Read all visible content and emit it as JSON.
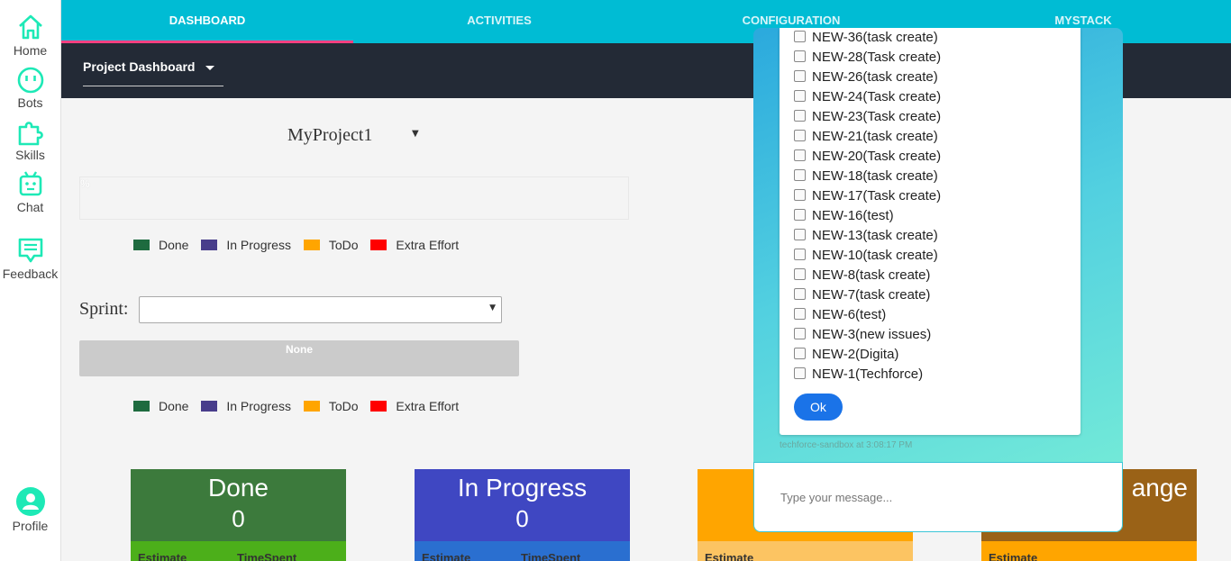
{
  "sidebar": {
    "items": [
      {
        "label": "Home",
        "icon": "home-icon"
      },
      {
        "label": "Bots",
        "icon": "bot-face-icon"
      },
      {
        "label": "Skills",
        "icon": "puzzle-icon"
      },
      {
        "label": "Chat",
        "icon": "robot-icon"
      },
      {
        "label": "Feedback",
        "icon": "message-icon"
      },
      {
        "label": "Profile",
        "icon": "user-icon"
      }
    ],
    "accent_color": "#1de9b6"
  },
  "tabs": [
    {
      "label": "DASHBOARD",
      "active": true
    },
    {
      "label": "ACTIVITIES",
      "active": false
    },
    {
      "label": "CONFIGURATION",
      "active": false
    },
    {
      "label": "MYSTACK",
      "active": false
    }
  ],
  "subheader": {
    "dropdown_label": "Project Dashboard"
  },
  "project": {
    "selected": "MyProject1"
  },
  "progress": {
    "label": "%"
  },
  "legend": [
    {
      "label": "Done",
      "color": "#1e6b3f"
    },
    {
      "label": "In Progress",
      "color": "#483d8b"
    },
    {
      "label": "ToDo",
      "color": "#ffa500"
    },
    {
      "label": "Extra Effort",
      "color": "#ff0000"
    }
  ],
  "sprint": {
    "label": "Sprint:",
    "value": "",
    "none_label": "None"
  },
  "cards": [
    {
      "title": "Done",
      "count": "0",
      "col1": "Estimate",
      "col2": "TimeSpent",
      "head_color": "#3c7a3c",
      "foot_color": "#4caf1a"
    },
    {
      "title": "In Progress",
      "count": "0",
      "col1": "Estimate",
      "col2": "TimeSpent",
      "head_color": "#3f47c2",
      "foot_color": "#2a6fd0"
    },
    {
      "title": "",
      "count": "",
      "col1": "Estimate",
      "col2": "",
      "head_color": "#ffa500",
      "foot_color": "#fcc462"
    },
    {
      "title": "ange",
      "count": "",
      "col1": "Estimate",
      "col2": "",
      "head_color": "#9a6217",
      "foot_color": "#ffa500"
    }
  ],
  "chat": {
    "tasks": [
      "NEW-36(task create)",
      "NEW-28(Task create)",
      "NEW-26(task create)",
      "NEW-24(Task create)",
      "NEW-23(Task create)",
      "NEW-21(task create)",
      "NEW-20(Task create)",
      "NEW-18(task create)",
      "NEW-17(Task create)",
      "NEW-16(test)",
      "NEW-13(task create)",
      "NEW-10(task create)",
      "NEW-8(task create)",
      "NEW-7(task create)",
      "NEW-6(test)",
      "NEW-3(new issues)",
      "NEW-2(Digita)",
      "NEW-1(Techforce)"
    ],
    "ok_label": "Ok",
    "timestamp": "techforce-sandbox at 3:08:17 PM",
    "input_placeholder": "Type your message..."
  }
}
